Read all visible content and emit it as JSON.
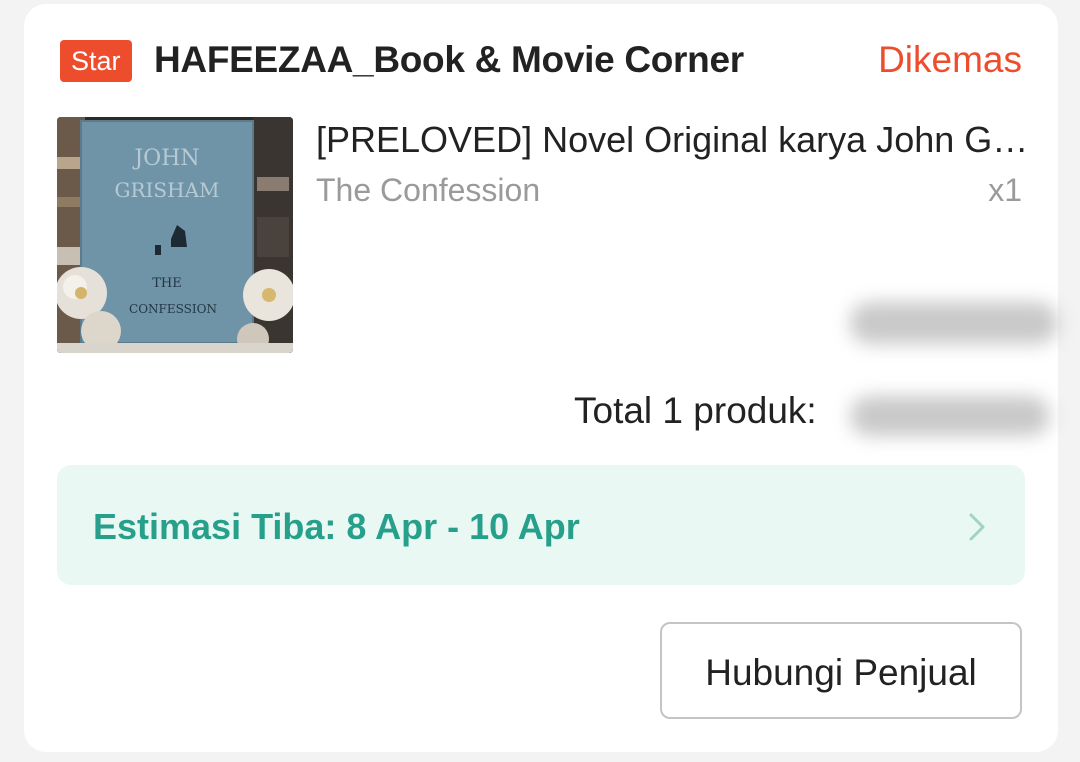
{
  "order": {
    "shop": {
      "badge": "Star",
      "name": "HAFEEZAA_Book & Movie Corner",
      "status": "Dikemas"
    },
    "product": {
      "title": "[PRELOVED] Novel Original karya John Grisham The Confession",
      "variant": "The Confession",
      "quantity": "x1",
      "image": {
        "cover_author_line1": "JOHN",
        "cover_author_line2": "GRISHAM",
        "cover_title_line1": "THE",
        "cover_title_line2": "CONFESSION"
      }
    },
    "total": {
      "label": "Total 1 produk:"
    },
    "estimate": {
      "text": "Estimasi Tiba: 8 Apr - 10 Apr"
    },
    "actions": {
      "contact_label": "Hubungi Penjual"
    }
  },
  "colors": {
    "accent": "#ee4d2d",
    "estimate_text": "#26a08a",
    "estimate_bg": "#eaf8f4"
  }
}
